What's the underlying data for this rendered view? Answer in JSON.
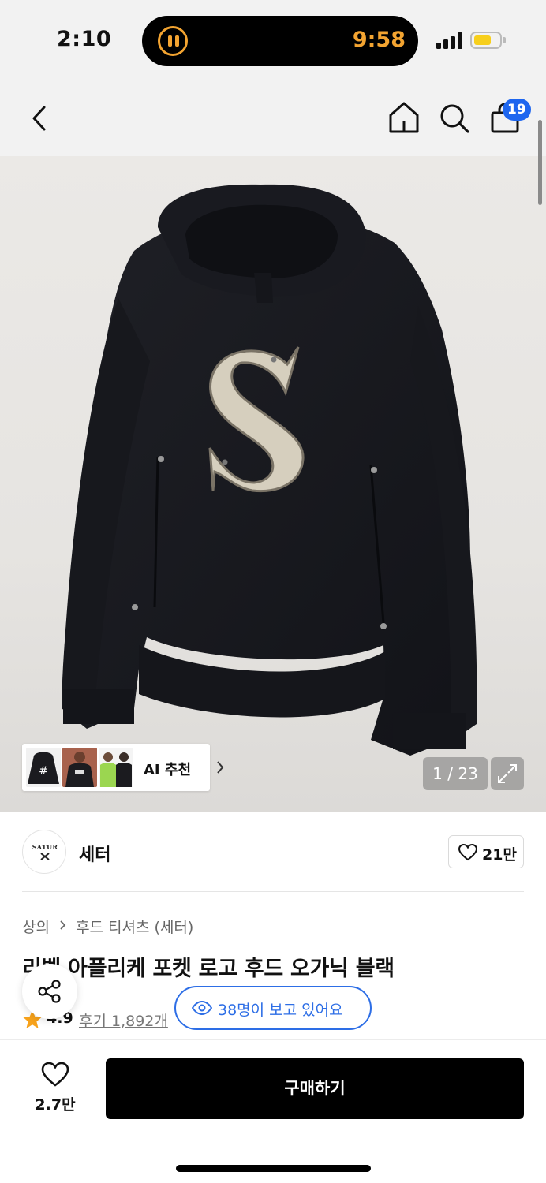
{
  "status_bar": {
    "time": "2:10",
    "activity_timer": "9:58",
    "battery_level": 0.65,
    "accent_color": "#f3a431"
  },
  "nav": {
    "back_icon": "chevron-left-icon",
    "home_icon": "home-icon",
    "search_icon": "search-icon",
    "cart_icon": "shopping-bag-icon",
    "cart_badge": "19",
    "badge_color": "#1e66ef"
  },
  "product_image": {
    "page_counter": "1 / 23",
    "expand_icon": "expand-icon",
    "ai_recommend": {
      "label": "AI 추천",
      "chevron": "chevron-right-icon"
    }
  },
  "brand": {
    "logo_text": "SATUR",
    "name": "세터",
    "like_count": "21만"
  },
  "breadcrumb": {
    "category": "상의",
    "subcategory": "후드 티셔츠 (세터)"
  },
  "product": {
    "title": "리벨 아플리케 포켓 로고 후드 오가닉 블랙",
    "rating": "4.9",
    "reviews": "후기 1,892개"
  },
  "viewers": {
    "text": "38명이 보고 있어요",
    "color": "#2d6ee6"
  },
  "bottom_bar": {
    "wish_count": "2.7만",
    "buy_label": "구매하기"
  }
}
